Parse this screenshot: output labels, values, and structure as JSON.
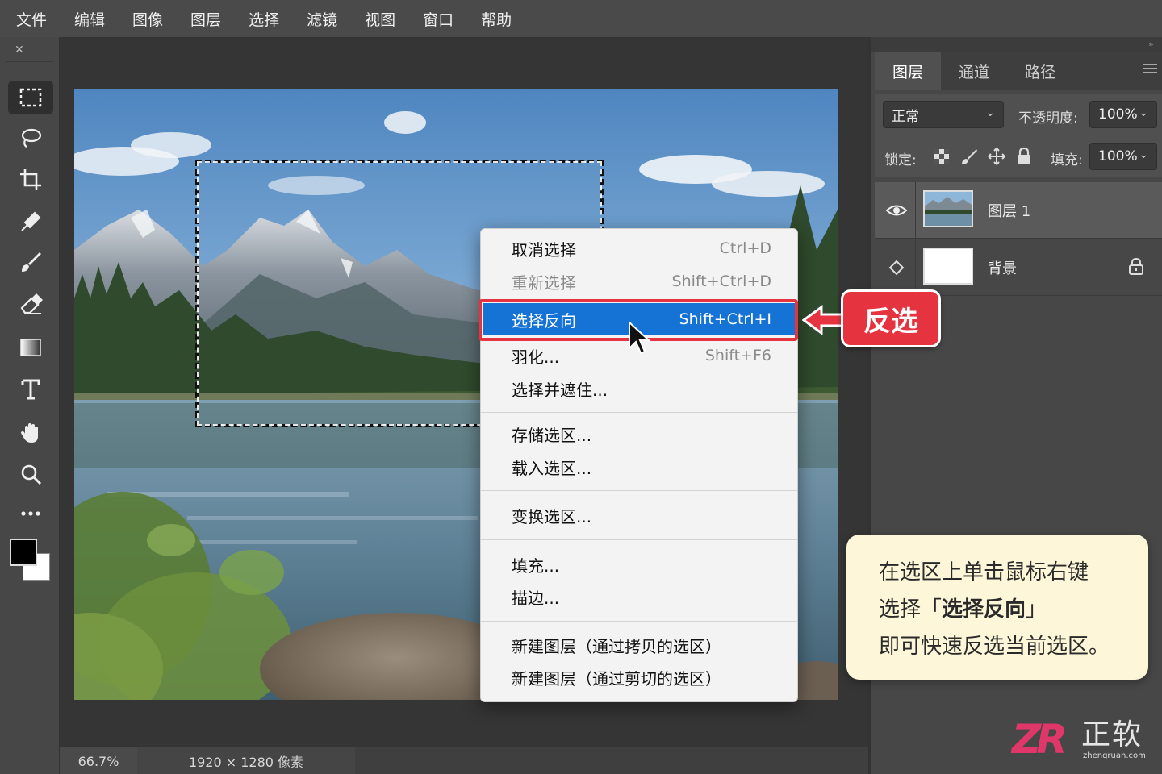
{
  "menubar": {
    "items": [
      "文件",
      "编辑",
      "图像",
      "图层",
      "选择",
      "滤镜",
      "视图",
      "窗口",
      "帮助"
    ]
  },
  "toolbar": {
    "collapse_glyph": "»",
    "tools": [
      {
        "name": "rectangular-marquee-icon",
        "active": true
      },
      {
        "name": "lasso-icon"
      },
      {
        "name": "crop-icon"
      },
      {
        "name": "eyedropper-icon"
      },
      {
        "name": "brush-icon"
      },
      {
        "name": "eraser-icon"
      },
      {
        "name": "gradient-icon"
      },
      {
        "name": "type-icon"
      },
      {
        "name": "hand-icon"
      },
      {
        "name": "zoom-icon"
      },
      {
        "name": "more-tools-icon"
      }
    ],
    "foreground_color": "#000000",
    "background_color": "#ffffff"
  },
  "status": {
    "zoom": "66.7%",
    "dimensions": "1920 × 1280 像素"
  },
  "layers_panel": {
    "tabs": [
      "图层",
      "通道",
      "路径"
    ],
    "active_tab": "图层",
    "blend_mode": "正常",
    "opacity_label": "不透明度:",
    "opacity_value": "100%",
    "lock_label": "锁定:",
    "fill_label": "填充:",
    "fill_value": "100%",
    "layers": [
      {
        "name": "图层 1",
        "visible": true,
        "selected": true
      },
      {
        "name": "背景",
        "visible": false,
        "locked": true
      }
    ]
  },
  "context_menu": {
    "items": [
      {
        "label": "取消选择",
        "shortcut": "Ctrl+D"
      },
      {
        "label": "重新选择",
        "shortcut": "Shift+Ctrl+D",
        "disabled": true
      },
      {
        "label": "选择反向",
        "shortcut": "Shift+Ctrl+I",
        "highlighted": true
      },
      {
        "label": "羽化...",
        "shortcut": "Shift+F6"
      },
      {
        "label": "选择并遮住...",
        "shortcut": ""
      },
      {
        "label": "存储选区...",
        "shortcut": ""
      },
      {
        "label": "载入选区...",
        "shortcut": ""
      },
      {
        "label": "变换选区...",
        "shortcut": ""
      },
      {
        "label": "填充...",
        "shortcut": ""
      },
      {
        "label": "描边...",
        "shortcut": ""
      },
      {
        "label": "新建图层（通过拷贝的选区）",
        "shortcut": ""
      },
      {
        "label": "新建图层（通过剪切的选区）",
        "shortcut": ""
      }
    ],
    "highlight_color": "#1673d6"
  },
  "callout": {
    "label": "反选",
    "color": "#e5343f"
  },
  "tip": {
    "line1": "在选区上单击鼠标右键",
    "line2_prefix": "选择「",
    "line2_bold": "选择反向",
    "line2_suffix": "」",
    "line3": "即可快速反选当前选区。"
  },
  "logo": {
    "mark": "ZR",
    "name": "正软",
    "url": "zhengruan.com"
  }
}
